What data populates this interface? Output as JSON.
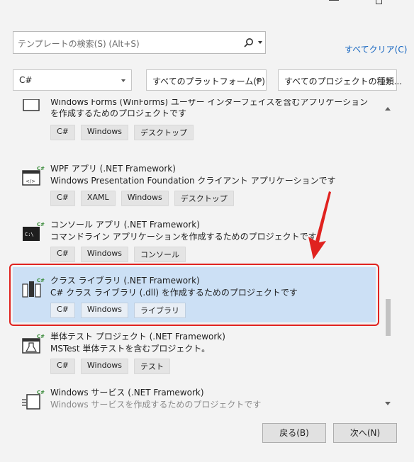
{
  "search": {
    "placeholder": "テンプレートの検索(S) (Alt+S)"
  },
  "clear_all": "すべてクリア(C)",
  "filters": [
    {
      "value": "C#"
    },
    {
      "value": "すべてのプラットフォーム(P)"
    },
    {
      "value": "すべてのプロジェクトの種類..."
    }
  ],
  "templates": [
    {
      "title": "",
      "desc": "Windows Forms (WinForms) ユーザー インターフェイスを含むアプリケーションを作成するためのプロジェクトです",
      "tags": [
        "C#",
        "Windows",
        "デスクトップ"
      ],
      "icon": "winforms-icon"
    },
    {
      "title": "WPF アプリ (.NET Framework)",
      "desc": "Windows Presentation Foundation クライアント アプリケーションです",
      "tags": [
        "C#",
        "XAML",
        "Windows",
        "デスクトップ"
      ],
      "icon": "wpf-app-icon"
    },
    {
      "title": "コンソール アプリ (.NET Framework)",
      "desc": "コマンドライン アプリケーションを作成するためのプロジェクトです",
      "tags": [
        "C#",
        "Windows",
        "コンソール"
      ],
      "icon": "console-app-icon"
    },
    {
      "title": "クラス ライブラリ (.NET Framework)",
      "desc": "C# クラス ライブラリ (.dll) を作成するためのプロジェクトです",
      "tags": [
        "C#",
        "Windows",
        "ライブラリ"
      ],
      "icon": "class-library-icon",
      "selected": true
    },
    {
      "title": "単体テスト プロジェクト (.NET Framework)",
      "desc": "MSTest 単体テストを含むプロジェクト。",
      "tags": [
        "C#",
        "Windows",
        "テスト"
      ],
      "icon": "unit-test-icon"
    },
    {
      "title": "Windows サービス (.NET Framework)",
      "desc": "Windows サービスを作成するためのプロジェクトです",
      "tags": [],
      "icon": "windows-service-icon"
    }
  ],
  "buttons": {
    "back": "戻る(B)",
    "next": "次へ(N)"
  },
  "colors": {
    "accent": "#1565c0",
    "selected_bg": "#cce0f5",
    "highlight": "#e0221f"
  }
}
